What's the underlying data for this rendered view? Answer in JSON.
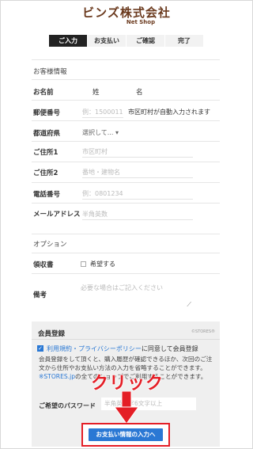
{
  "brand": {
    "logo_main": "ビンズ株式会社",
    "logo_sub": "Net Shop"
  },
  "steps": [
    {
      "label": "ご入力"
    },
    {
      "label": "お支払い"
    },
    {
      "label": "ご確認"
    },
    {
      "label": "完了"
    }
  ],
  "customer": {
    "section_title": "お客様情報",
    "name_label": "お名前",
    "last_name": "姓",
    "first_name": "名",
    "postal_label": "郵便番号",
    "postal_placeholder": "例：1500011",
    "postal_hint": "市区町村が自動入力されます",
    "prefecture_label": "都道府県",
    "prefecture_value": "選択して...",
    "address1_label": "ご住所1",
    "address1_placeholder": "市区町村",
    "address2_label": "ご住所2",
    "address2_placeholder": "番地・建物名",
    "phone_label": "電話番号",
    "phone_placeholder": "例：0801234",
    "email_label": "メールアドレス",
    "email_placeholder": "半角英数"
  },
  "options": {
    "section_title": "オプション",
    "receipt_label": "領収書",
    "receipt_checkbox": "希望する",
    "notes_label": "備考",
    "notes_placeholder": "必要な場合はご記入ください"
  },
  "member": {
    "title": "会員登録",
    "stores_mark": "©STORES®",
    "agree_link": "利用規約・プライバシーポリシー",
    "agree_rest": "に同意して会員登録",
    "desc_text": "会員登録をして頂くと、購入履歴が確認できるほか、次回のご注文から住所やお支払い方法の入力を省略することができます。",
    "desc_link": "※STORES.jp",
    "desc_rest": "の全てのショップでご利用することができます。",
    "password_label": "ご希望のパスワード",
    "password_placeholder": "半角英数字6文字以上"
  },
  "annotation": {
    "click_text": "クリック"
  },
  "submit": {
    "label": "お支払い情報の入力へ"
  },
  "colors": {
    "accent_red": "#e41e26",
    "primary_blue": "#2a78d4",
    "brand_brown": "#6b3a1e"
  }
}
